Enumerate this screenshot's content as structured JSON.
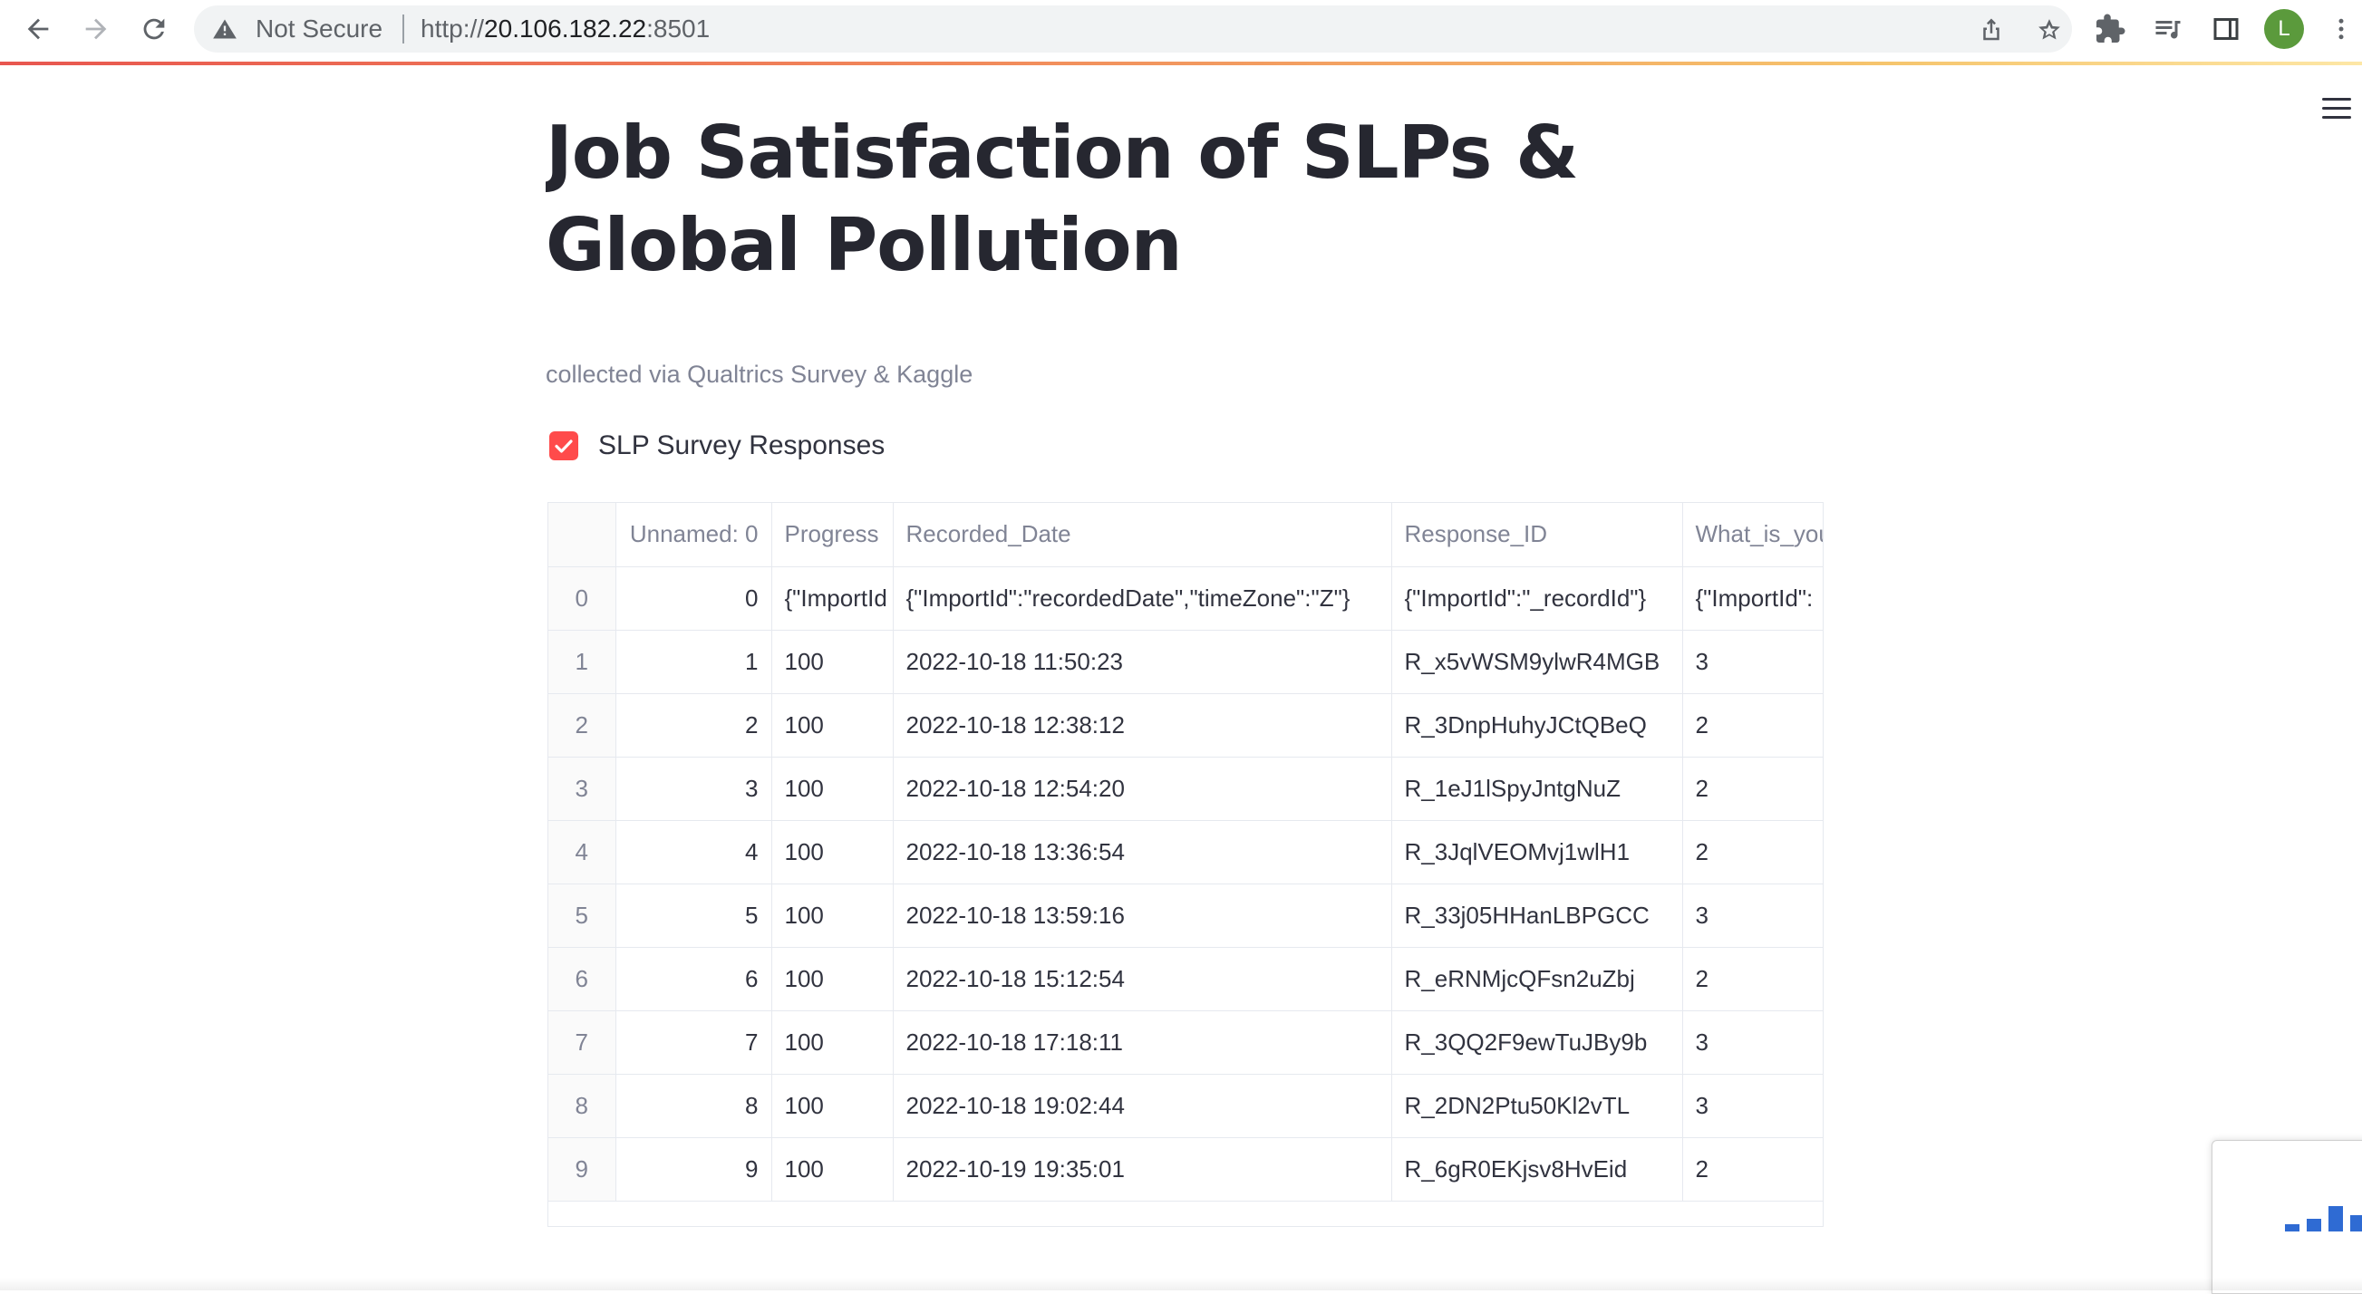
{
  "browser": {
    "security_text": "Not Secure",
    "url_scheme": "http://",
    "url_host": "20.106.182.22",
    "url_port": ":8501",
    "profile_initial": "L"
  },
  "page": {
    "title": "Job Satisfaction of SLPs & Global Pollution",
    "subtitle": "collected via Qualtrics Survey & Kaggle",
    "checkbox_label": "SLP Survey Responses",
    "checkbox_checked": true
  },
  "table": {
    "columns": [
      "",
      "Unnamed: 0",
      "Progress",
      "Recorded_Date",
      "Response_ID",
      "What_is_you"
    ],
    "rows": [
      [
        "0",
        "0",
        "{\"ImportId",
        "{\"ImportId\":\"recordedDate\",\"timeZone\":\"Z\"}",
        "{\"ImportId\":\"_recordId\"}",
        "{\"ImportId\":"
      ],
      [
        "1",
        "1",
        "100",
        "2022-10-18 11:50:23",
        "R_x5vWSM9ylwR4MGB",
        "3"
      ],
      [
        "2",
        "2",
        "100",
        "2022-10-18 12:38:12",
        "R_3DnpHuhyJCtQBeQ",
        "2"
      ],
      [
        "3",
        "3",
        "100",
        "2022-10-18 12:54:20",
        "R_1eJ1lSpyJntgNuZ",
        "2"
      ],
      [
        "4",
        "4",
        "100",
        "2022-10-18 13:36:54",
        "R_3JqlVEOMvj1wlH1",
        "2"
      ],
      [
        "5",
        "5",
        "100",
        "2022-10-18 13:59:16",
        "R_33j05HHanLBPGCC",
        "3"
      ],
      [
        "6",
        "6",
        "100",
        "2022-10-18 15:12:54",
        "R_eRNMjcQFsn2uZbj",
        "2"
      ],
      [
        "7",
        "7",
        "100",
        "2022-10-18 17:18:11",
        "R_3QQ2F9ewTuJBy9b",
        "3"
      ],
      [
        "8",
        "8",
        "100",
        "2022-10-18 19:02:44",
        "R_2DN2Ptu50Kl2vTL",
        "3"
      ],
      [
        "9",
        "9",
        "100",
        "2022-10-19 19:35:01",
        "R_6gR0EKjsv8HvEid",
        "2"
      ]
    ]
  },
  "colors": {
    "accent": "#ff4b4b",
    "text": "#31333f",
    "muted": "#808495",
    "grid": "#e6e9ef"
  }
}
